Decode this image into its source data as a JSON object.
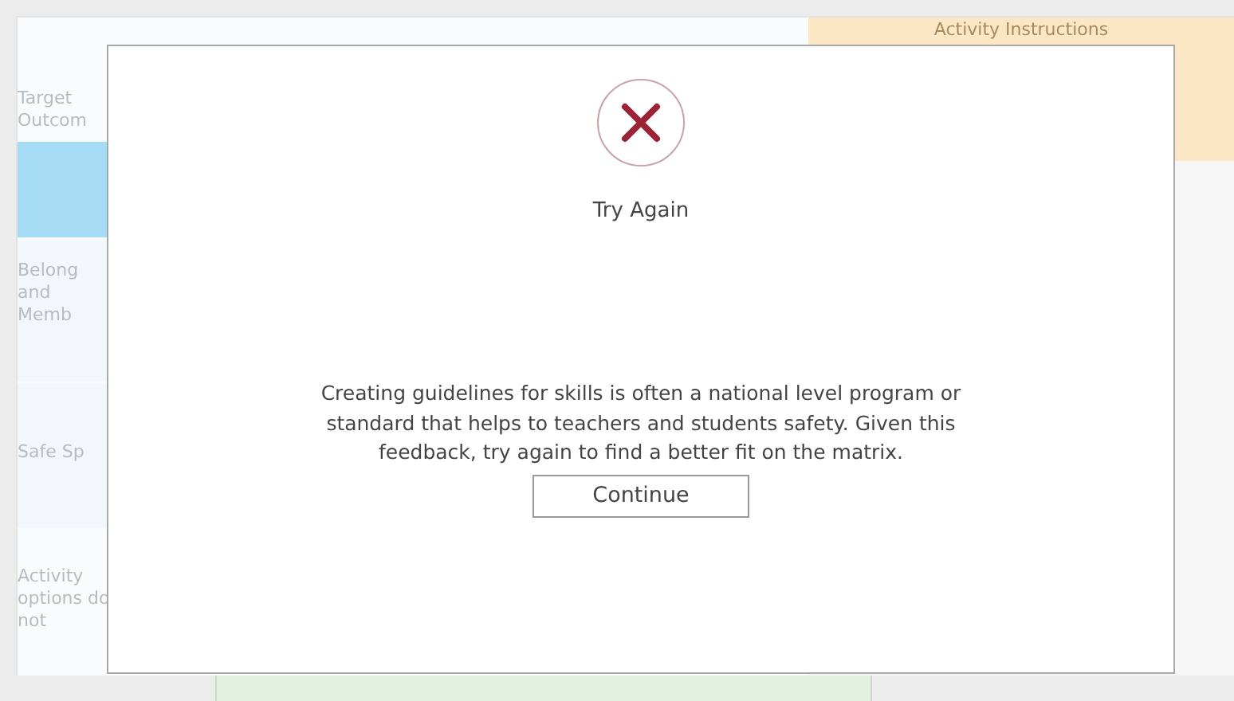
{
  "background": {
    "left_column": [
      {
        "text": "Target Outcom",
        "kind": "plain"
      },
      {
        "kind": "highlight"
      },
      {
        "text": "Belong and Memb",
        "kind": "plain"
      },
      {
        "text": "Safe Sp",
        "kind": "plain"
      },
      {
        "text": "Activity options do not",
        "kind": "plain"
      }
    ],
    "right_header": "Activity Instructions"
  },
  "dialog": {
    "title": "Try Again",
    "message": "Creating guidelines for skills is often a national level program or standard that helps to teachers and students safety. Given this feedback, try again to find a better fit on the matrix.",
    "button": "Continue"
  }
}
